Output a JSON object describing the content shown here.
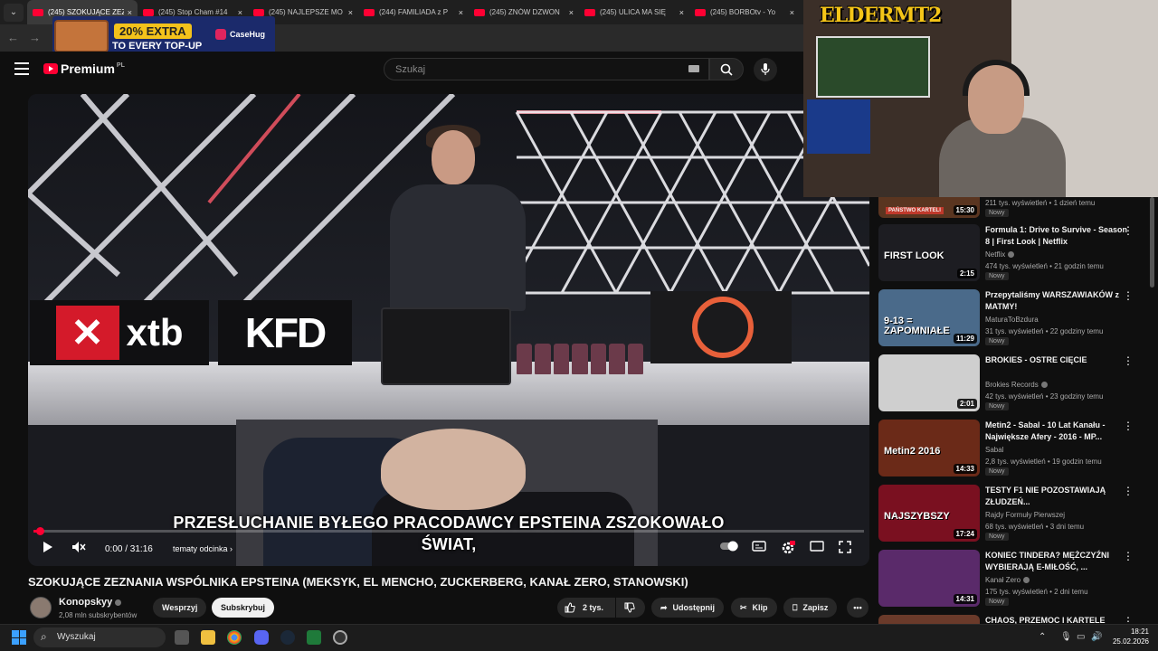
{
  "browser": {
    "tabs": [
      {
        "label": "(245) SZOKUJĄCE ZEZ",
        "active": true
      },
      {
        "label": "(245) Stop Cham #14",
        "active": false
      },
      {
        "label": "(245) NAJLEPSZE MO",
        "active": false
      },
      {
        "label": "(244) FAMILIADA z P",
        "active": false
      },
      {
        "label": "(245) ZNÓW DZWON",
        "active": false
      },
      {
        "label": "(245) ULICA MA SIĘ",
        "active": false
      },
      {
        "label": "(245) BORBOtv - Yo",
        "active": false
      }
    ],
    "close_glyph": "×"
  },
  "ad": {
    "line1": "20% EXTRA",
    "line2": "TO EVERY TOP-UP",
    "brand": "CaseHug"
  },
  "header": {
    "logo_text": "Premium",
    "region": "PL",
    "search_placeholder": "Szukaj"
  },
  "player": {
    "subtitle_line1": "PRZESŁUCHANIE BYŁEGO PRACODAWCY EPSTEINA ZSZOKOWAŁO",
    "subtitle_line2": "ŚWIAT,",
    "time": "0:00 / 31:16",
    "chapter": "tematy odcinka",
    "progress": 0.008,
    "sponsor_1": "xtb",
    "sponsor_2": "KFD"
  },
  "video": {
    "title": "SZOKUJĄCE ZEZNANIA WSPÓLNIKA EPSTEINA (MEKSYK, EL MENCHO, ZUCKERBERG, KANAŁ ZERO, STANOWSKI)",
    "channel": "Konopskyy",
    "subscribers": "2,08 mln subskrybentów",
    "support_label": "Wesprzyj",
    "subscribe_label": "Subskrybuj",
    "likes": "2 tys.",
    "share_label": "Udostępnij",
    "clip_label": "Klip",
    "save_label": "Zapisz"
  },
  "webcam": {
    "overlay_logo": "ELDERMT2"
  },
  "sidebar": {
    "partial_top": {
      "meta": "211 tys. wyświetleń • 1 dzień temu",
      "badge": "Nowy",
      "dur": "15:30",
      "thumb_text": "PAŃSTWO KARTELI"
    },
    "items": [
      {
        "title": "Formula 1: Drive to Survive - Season 8 | First Look | Netflix",
        "channel": "Netflix",
        "verified": true,
        "meta": "474 tys. wyświetleń • 21 godzin temu",
        "badge": "Nowy",
        "duration": "2:15",
        "thumb_text": "FIRST LOOK",
        "thumb_color": "#1d1d22"
      },
      {
        "title": "Przepytaliśmy WARSZAWIAKÓW z MATMY!",
        "channel": "MaturaToBzdura",
        "verified": false,
        "meta": "31 tys. wyświetleń • 22 godziny temu",
        "badge": "Nowy",
        "duration": "11:29",
        "thumb_text": "9-13 = ZAPOMNIAŁE",
        "thumb_color": "#4a6a8a"
      },
      {
        "title": "BROKIES - OSTRE CIĘCIE",
        "channel": "Brokies Records",
        "verified": true,
        "meta": "42 tys. wyświetleń • 23 godziny temu",
        "badge": "Nowy",
        "duration": "2:01",
        "thumb_text": "",
        "thumb_color": "#cfcfcf"
      },
      {
        "title": "Metin2 - Sabal - 10 Lat Kanału - Największe Afery - 2016 - MP...",
        "channel": "Sabal",
        "verified": false,
        "meta": "2,8 tys. wyświetleń • 19 godzin temu",
        "badge": "Nowy",
        "duration": "14:33",
        "thumb_text": "Metin2 2016",
        "thumb_color": "#6b2a18"
      },
      {
        "title": "TESTY F1 NIE POZOSTAWIAJĄ ZŁUDZEŃ...",
        "channel": "Rajdy Formuły Pierwszej",
        "verified": false,
        "meta": "68 tys. wyświetleń • 3 dni temu",
        "badge": "Nowy",
        "duration": "17:24",
        "thumb_text": "NAJSZYBSZY",
        "thumb_color": "#7a1020"
      },
      {
        "title": "KONIEC TINDERA? MĘŻCZYŹNI WYBIERAJĄ E-MIŁOŚĆ, ...",
        "channel": "Kanał Zero",
        "verified": true,
        "meta": "175 tys. wyświetleń • 2 dni temu",
        "badge": "Nowy",
        "duration": "14:31",
        "thumb_text": "",
        "thumb_color": "#5a2a6a"
      },
      {
        "title": "CHAOS, PRZEMOC I KARTELE",
        "channel": "",
        "verified": false,
        "meta": "",
        "badge": "",
        "duration": "",
        "thumb_text": "",
        "thumb_color": "#6a3a2a"
      }
    ]
  },
  "taskbar": {
    "search_label": "Wyszukaj",
    "time": "18:21",
    "date": "25.02.2026"
  }
}
